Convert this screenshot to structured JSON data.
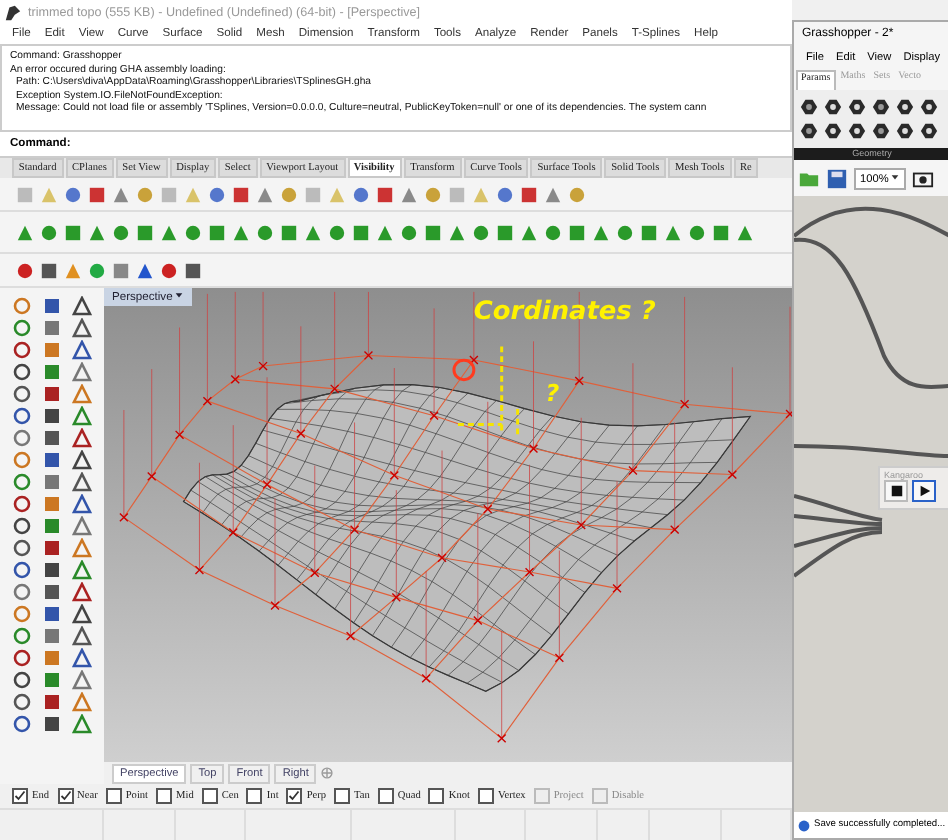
{
  "rhino": {
    "title": "trimmed topo (555 KB) - Undefined (Undefined) (64-bit) - [Perspective]",
    "menu": [
      "File",
      "Edit",
      "View",
      "Curve",
      "Surface",
      "Solid",
      "Mesh",
      "Dimension",
      "Transform",
      "Tools",
      "Analyze",
      "Render",
      "Panels",
      "T-Splines",
      "Help"
    ],
    "command_history": [
      {
        "text": "Command: Grasshopper",
        "indented": false
      },
      {
        "text": "An error occured during GHA assembly loading:",
        "indented": false
      },
      {
        "text": "Path: C:\\Users\\diva\\AppData\\Roaming\\Grasshopper\\Libraries\\TSplinesGH.gha",
        "indented": true
      },
      {
        "text": "Exception System.IO.FileNotFoundException:",
        "indented": true
      },
      {
        "text": "Message: Could not load file or assembly 'TSplines, Version=0.0.0.0, Culture=neutral, PublicKeyToken=null' or one of its dependencies. The system cann",
        "indented": true
      }
    ],
    "command_prompt": "Command:",
    "toolbar_tabs": [
      {
        "label": "Standard",
        "selected": false
      },
      {
        "label": "CPlanes",
        "selected": false
      },
      {
        "label": "Set View",
        "selected": false
      },
      {
        "label": "Display",
        "selected": false
      },
      {
        "label": "Select",
        "selected": false
      },
      {
        "label": "Viewport Layout",
        "selected": false
      },
      {
        "label": "Visibility",
        "selected": true
      },
      {
        "label": "Transform",
        "selected": false
      },
      {
        "label": "Curve Tools",
        "selected": false
      },
      {
        "label": "Surface Tools",
        "selected": false
      },
      {
        "label": "Solid Tools",
        "selected": false
      },
      {
        "label": "Mesh Tools",
        "selected": false
      },
      {
        "label": "Re",
        "selected": false
      }
    ],
    "viewport": {
      "label": "Perspective",
      "annotation": "Cordinates ?",
      "annotation_mark": "?"
    },
    "viewport_tabs": [
      {
        "label": "Perspective",
        "selected": true
      },
      {
        "label": "Top",
        "selected": false
      },
      {
        "label": "Front",
        "selected": false
      },
      {
        "label": "Right",
        "selected": false
      }
    ],
    "osnaps": [
      {
        "label": "End",
        "checked": true,
        "disabled": false
      },
      {
        "label": "Near",
        "checked": true,
        "disabled": false
      },
      {
        "label": "Point",
        "checked": false,
        "disabled": false
      },
      {
        "label": "Mid",
        "checked": false,
        "disabled": false
      },
      {
        "label": "Cen",
        "checked": false,
        "disabled": false
      },
      {
        "label": "Int",
        "checked": false,
        "disabled": false
      },
      {
        "label": "Perp",
        "checked": true,
        "disabled": false
      },
      {
        "label": "Tan",
        "checked": false,
        "disabled": false
      },
      {
        "label": "Quad",
        "checked": false,
        "disabled": false
      },
      {
        "label": "Knot",
        "checked": false,
        "disabled": false
      },
      {
        "label": "Vertex",
        "checked": false,
        "disabled": false
      },
      {
        "label": "Project",
        "checked": false,
        "disabled": true
      },
      {
        "label": "Disable",
        "checked": false,
        "disabled": true
      }
    ]
  },
  "grasshopper": {
    "title": "Grasshopper - 2*",
    "menu": [
      "File",
      "Edit",
      "View",
      "Display"
    ],
    "tabs": [
      {
        "label": "Params",
        "selected": true
      },
      {
        "label": "Maths",
        "selected": false
      },
      {
        "label": "Sets",
        "selected": false
      },
      {
        "label": "Vecto",
        "selected": false
      }
    ],
    "panel_label": "Geometry",
    "zoom": "100%",
    "component": {
      "title": "Kangaroo"
    },
    "status": "Save successfully completed..."
  }
}
